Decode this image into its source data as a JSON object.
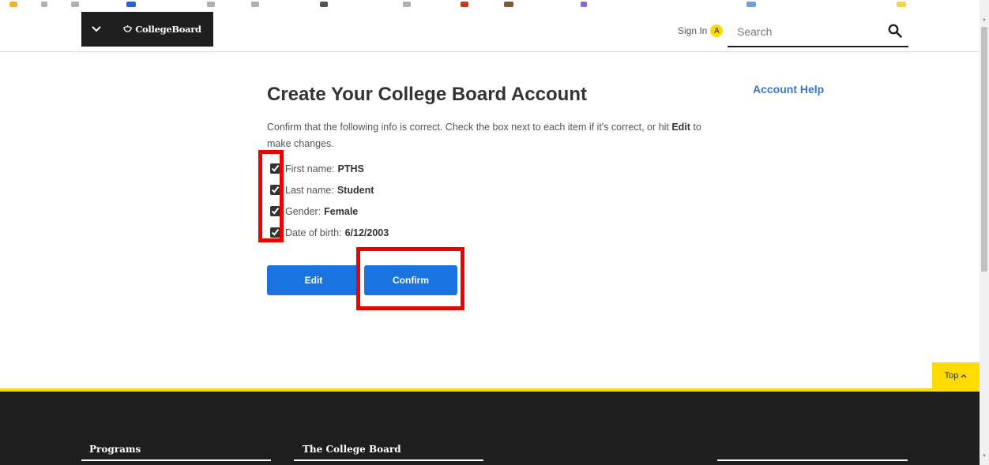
{
  "header": {
    "logo_text": "CollegeBoard",
    "sign_in_label": "Sign In",
    "avatar_letter": "A",
    "search_placeholder": "Search"
  },
  "main": {
    "title": "Create Your College Board Account",
    "account_help": "Account Help",
    "intro_before": "Confirm that the following info is correct. Check the box next to each item if it's correct, or hit ",
    "intro_bold": "Edit",
    "intro_after": " to make changes.",
    "items": [
      {
        "label": "First name:",
        "value": "PTHS",
        "checked": true
      },
      {
        "label": "Last name:",
        "value": "Student",
        "checked": true
      },
      {
        "label": "Gender:",
        "value": "Female",
        "checked": true
      },
      {
        "label": "Date of birth:",
        "value": "6/12/2003",
        "checked": true
      }
    ],
    "edit_label": "Edit",
    "confirm_label": "Confirm"
  },
  "top_button": "Top",
  "footer": {
    "programs": "Programs",
    "college_board": "The College Board"
  },
  "colors": {
    "accent_blue": "#1b73e0",
    "brand_yellow": "#fedb00",
    "highlight_red": "#ee0000",
    "dark": "#1e1e1e"
  }
}
